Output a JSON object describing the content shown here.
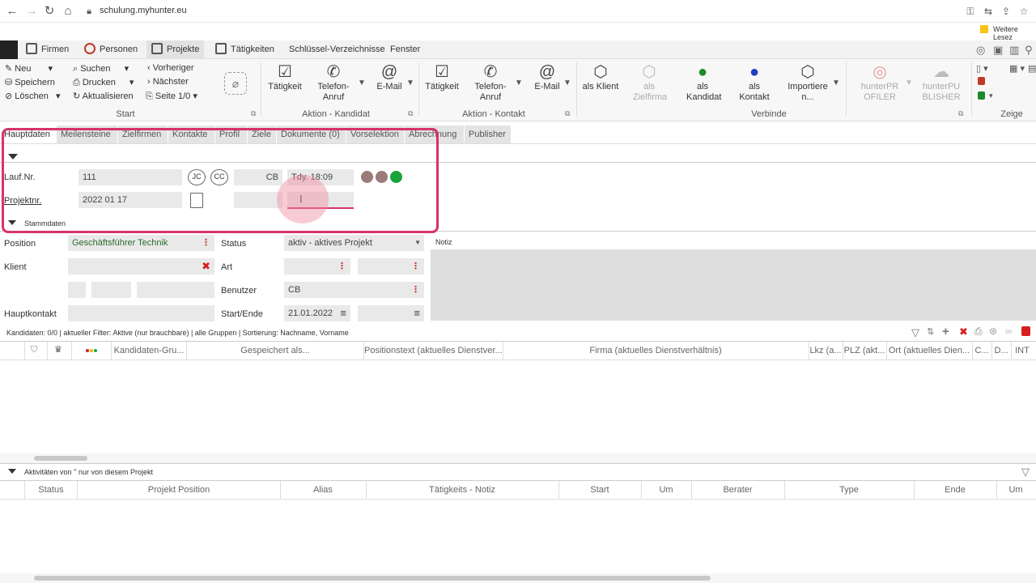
{
  "browser": {
    "url": "schulung.myhunter.eu",
    "bookmark": "Weitere Lesez"
  },
  "menu": {
    "items": [
      "Firmen",
      "Personen",
      "Projekte",
      "Tätigkeiten",
      "Schlüssel-Verzeichnisse",
      "Fenster"
    ]
  },
  "ribbon": {
    "start": {
      "new": "Neu",
      "save": "Speichern",
      "delete": "Löschen",
      "search": "Suchen",
      "print": "Drucken",
      "refresh": "Aktualisieren",
      "prev": "Vorheriger",
      "next": "Nächster",
      "page": "Seite 1/0",
      "group": "Start"
    },
    "kandidat": {
      "activity": "Tätigkeit",
      "phone": "Telefon-Anruf",
      "email": "E-Mail",
      "group": "Aktion - Kandidat"
    },
    "kontakt": {
      "activity": "Tätigkeit",
      "phone": "Telefon-Anruf",
      "email": "E-Mail",
      "group": "Aktion - Kontakt"
    },
    "verbinde": {
      "client": "als Klient",
      "target": "als Zielfirma",
      "candidate": "als Kandidat",
      "contact": "als Kontakt",
      "import": "Importieren...",
      "group": "Verbinde"
    },
    "publish": {
      "profiler": "hunterPROFILER",
      "publisher": "hunterPUBLISHER"
    },
    "zeige": {
      "group": "Zeige"
    }
  },
  "tabs": [
    "Hauptdaten",
    "Meilensteine",
    "Zielfirmen",
    "Kontakte",
    "Profil",
    "Ziele",
    "Dokumente (0)",
    "Vorselektion",
    "Abrechnung",
    "Publisher"
  ],
  "form": {
    "lauf_label": "Lauf.Nr.",
    "lauf_value": "111",
    "user_code": "CB",
    "time": "Tdy. 18:09",
    "projektnr_label": "Projektnr.",
    "projektnr_value": "2022 01 17",
    "stammdaten": "Stammdaten",
    "position_label": "Position",
    "position_value": "Geschäftsführer Technik",
    "status_label": "Status",
    "status_value": "aktiv - aktives Projekt",
    "notiz": "Notiz",
    "klient_label": "Klient",
    "art_label": "Art",
    "benutzer_label": "Benutzer",
    "benutzer_value": "CB",
    "hauptkontakt_label": "Hauptkontakt",
    "startende_label": "Start/Ende",
    "start_value": "21.01.2022"
  },
  "candidates": {
    "info": "Kandidaten: 0/0 | aktueller Filter: Aktive (nur brauchbare) | alle Gruppen | Sortierung: Nachname, Vorname",
    "columns": [
      "Kandidaten-Gru...",
      "Gespeichert als...",
      "Positionstext (aktuelles Dienstver...",
      "Firma (aktuelles Dienstverhältnis)",
      "Lkz (a...",
      "PLZ (akt...",
      "Ort (aktuelles Dien...",
      "C...",
      "D...",
      "INT"
    ]
  },
  "activities": {
    "title": "Aktivitäten von '' nur von diesem Projekt",
    "columns": [
      "Status",
      "Projekt Position",
      "Alias",
      "Tätigkeits - Notiz",
      "Start",
      "Um",
      "Berater",
      "Type",
      "Ende",
      "Um"
    ]
  },
  "colors": {
    "accent": "#d6336c",
    "green": "#1aa33a",
    "brown": "#9a7b78",
    "red": "#c0392b"
  }
}
